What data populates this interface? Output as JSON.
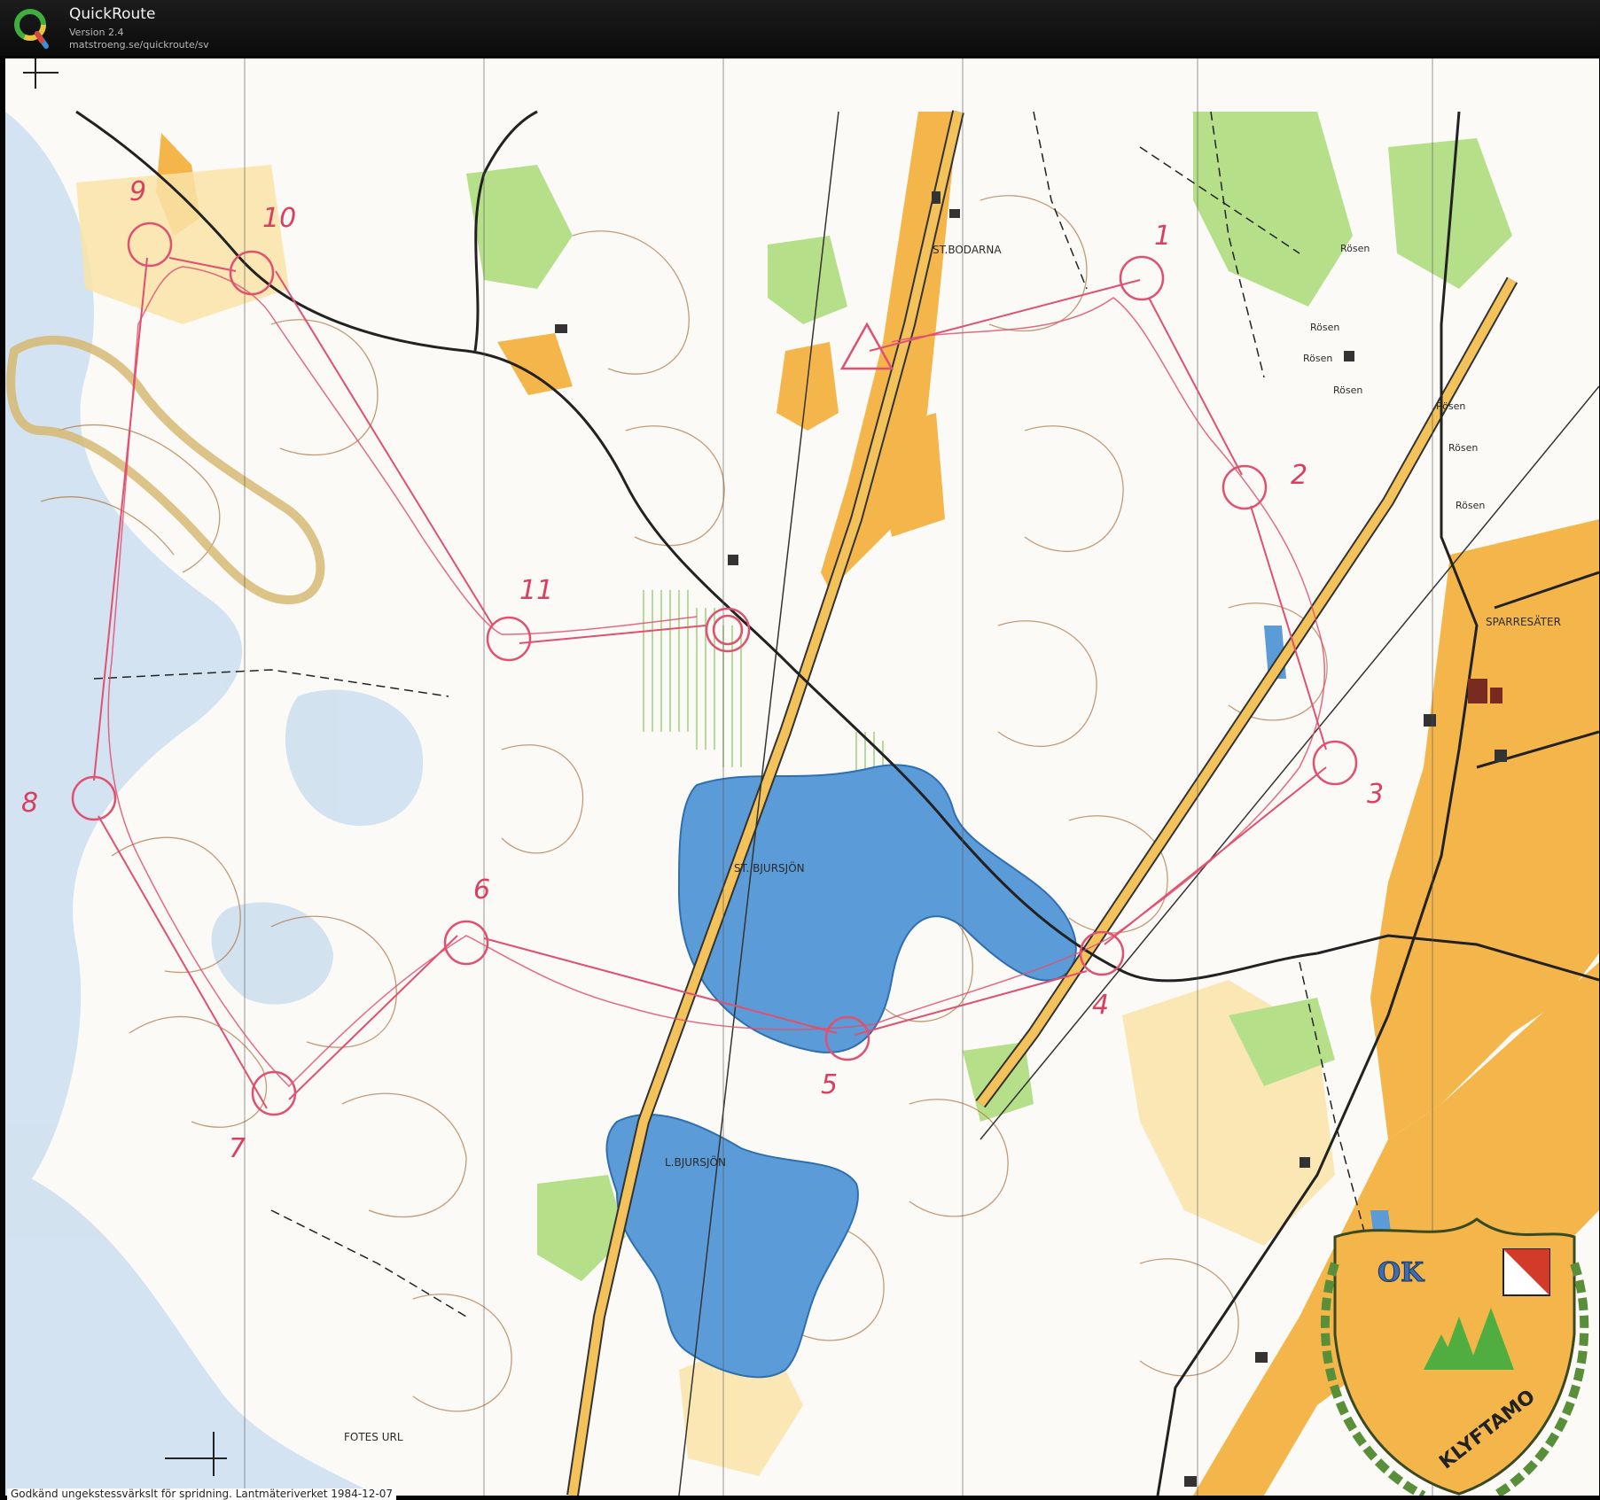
{
  "app": {
    "name": "QuickRoute",
    "version": "Version 2.4",
    "url": "matstroeng.se/quickroute/sv"
  },
  "map": {
    "place_labels": {
      "st_bodarna": "ST.BODARNA",
      "sparresater": "SPARRESÄTER",
      "st_bjursjon": "ST. BJURSJÖN",
      "l_bjursjon": "L.BJURSJÖN",
      "fotes_url": "FOTES URL",
      "rosen": "Rösen"
    },
    "control_numbers": [
      "1",
      "2",
      "3",
      "4",
      "5",
      "6",
      "7",
      "8",
      "9",
      "10",
      "11"
    ],
    "club_logo": {
      "top_text": "OK",
      "bottom_text": "KLYFTAMO"
    },
    "footer_note": "Godkänd ungekstessvärkslt för spridning. Lantmäteriverket 1984-12-07"
  },
  "colors": {
    "water": "#5a9bd8",
    "open_land": "#f4b64a",
    "green": "#a9d87a",
    "route": "#e0506f",
    "contour": "#b07a4a"
  }
}
